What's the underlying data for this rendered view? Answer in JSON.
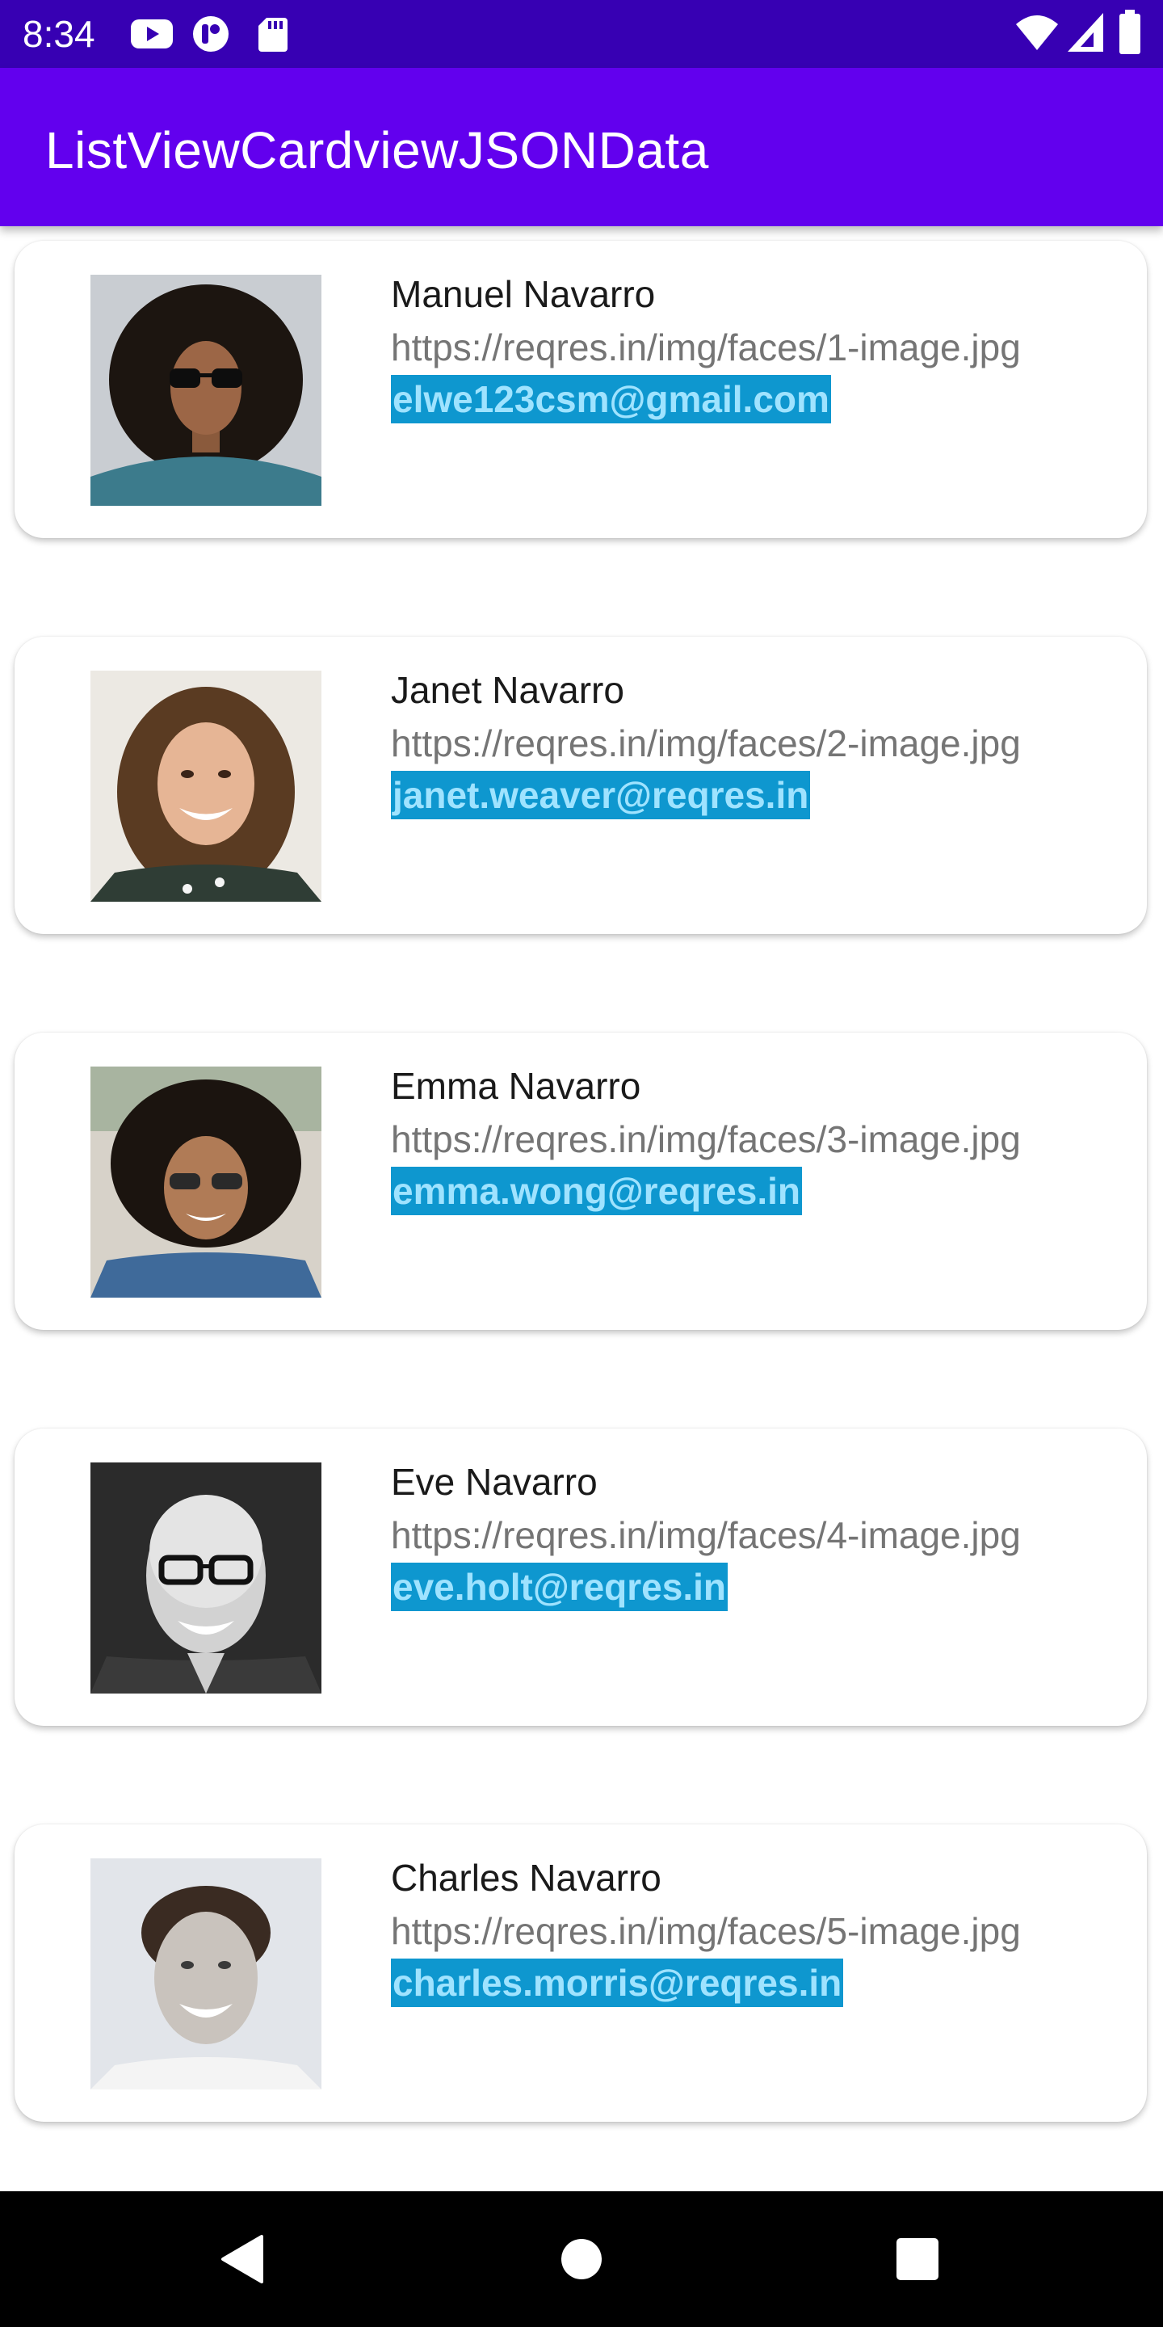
{
  "status_bar": {
    "time": "8:34",
    "left_icons": [
      "youtube-icon",
      "app-notification-icon",
      "sd-card-icon"
    ],
    "right_icons": [
      "wifi-icon",
      "cell-signal-icon",
      "battery-icon"
    ]
  },
  "app_bar": {
    "title": "ListViewCardviewJSONData",
    "color": "#6200ee",
    "status_color": "#3700b3"
  },
  "list": {
    "items": [
      {
        "name": "Manuel Navarro",
        "url": "https://reqres.in/img/faces/1-image.jpg",
        "email": "elwe123csm@gmail.com"
      },
      {
        "name": "Janet Navarro",
        "url": "https://reqres.in/img/faces/2-image.jpg",
        "email": "janet.weaver@reqres.in"
      },
      {
        "name": "Emma Navarro",
        "url": "https://reqres.in/img/faces/3-image.jpg",
        "email": "emma.wong@reqres.in"
      },
      {
        "name": "Eve Navarro",
        "url": "https://reqres.in/img/faces/4-image.jpg",
        "email": "eve.holt@reqres.in"
      },
      {
        "name": "Charles Navarro",
        "url": "https://reqres.in/img/faces/5-image.jpg",
        "email": "charles.morris@reqres.in"
      }
    ]
  },
  "nav_bar": {
    "buttons": [
      "back-icon",
      "home-icon",
      "recents-icon"
    ]
  }
}
